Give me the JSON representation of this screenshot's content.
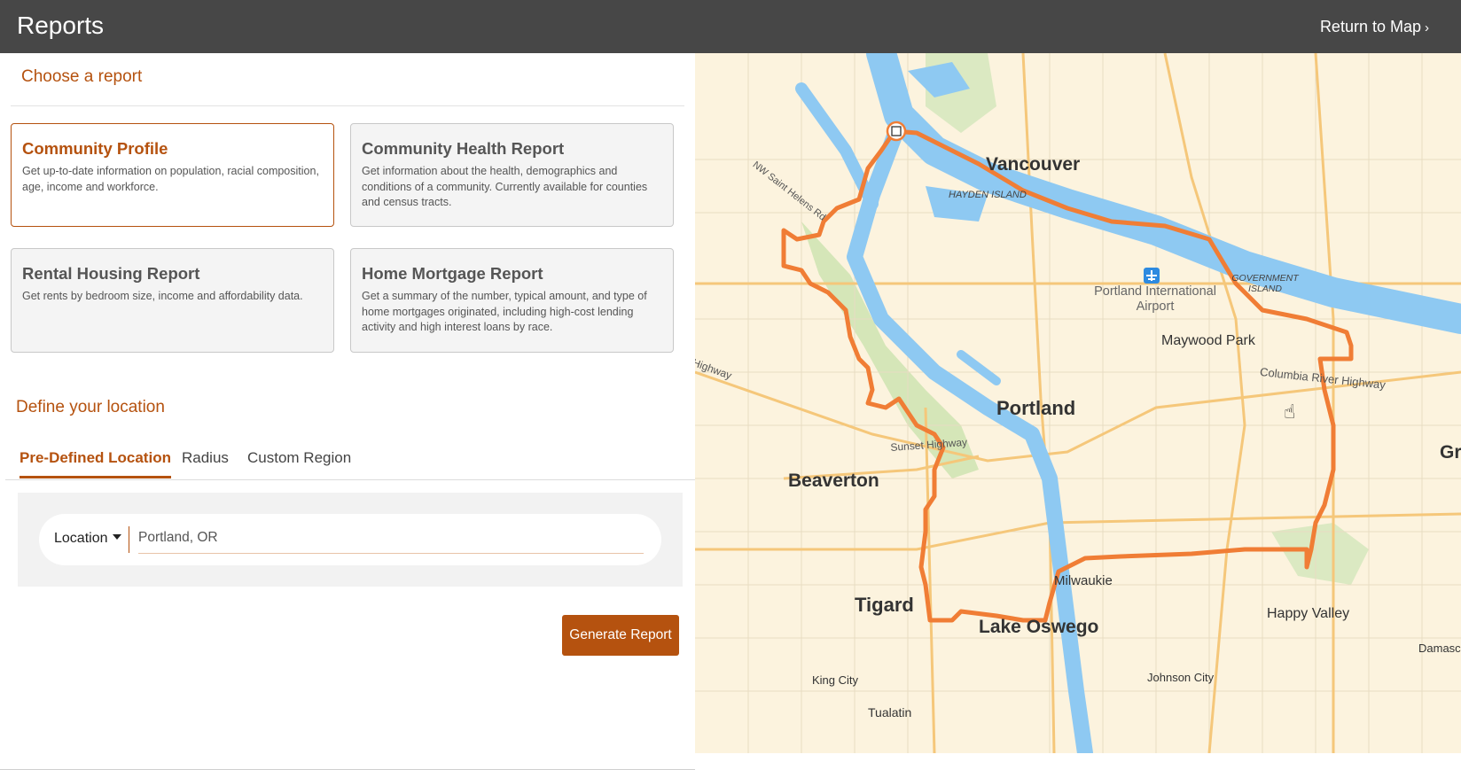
{
  "header": {
    "title": "Reports",
    "return_label": "Return to Map",
    "return_chevron": "›"
  },
  "choose": {
    "title": "Choose a report",
    "cards": [
      {
        "title": "Community Profile",
        "desc": "Get up-to-date information on population, racial composition, age, income and workforce.",
        "active": true
      },
      {
        "title": "Community Health Report",
        "desc": "Get information about the health, demographics and conditions of a community. Currently available for counties and census tracts.",
        "active": false
      },
      {
        "title": "Rental Housing Report",
        "desc": "Get rents by bedroom size, income and affordability data.",
        "active": false
      },
      {
        "title": "Home Mortgage Report",
        "desc": "Get a summary of the number, typical amount, and type of home mortgages originated, including high-cost lending activity and high interest loans by race.",
        "active": false
      }
    ]
  },
  "location": {
    "title": "Define your location",
    "tabs": [
      "Pre-Defined Location",
      "Radius",
      "Custom Region"
    ],
    "active_tab": "Pre-Defined Location",
    "dropdown_label": "Location",
    "input_value": "Portland, OR"
  },
  "generate_label": "Generate Report",
  "map": {
    "labels": [
      {
        "id": "vancouver",
        "text": "Vancouver"
      },
      {
        "id": "hayden",
        "text": "HAYDEN ISLAND"
      },
      {
        "id": "sthelens",
        "text": "NW Saint Helens Rd"
      },
      {
        "id": "airport",
        "text": "Portland International Airport"
      },
      {
        "id": "government",
        "text": "GOVERNMENT ISLAND"
      },
      {
        "id": "maywood",
        "text": "Maywood Park"
      },
      {
        "id": "columbia",
        "text": "Columbia River Highway"
      },
      {
        "id": "highway",
        "text": "Highway"
      },
      {
        "id": "portland",
        "text": "Portland"
      },
      {
        "id": "sunset",
        "text": "Sunset Highway"
      },
      {
        "id": "beaverton",
        "text": "Beaverton"
      },
      {
        "id": "gr",
        "text": "Gr"
      },
      {
        "id": "milwaukie",
        "text": "Milwaukie"
      },
      {
        "id": "tigard",
        "text": "Tigard"
      },
      {
        "id": "lakeoswego",
        "text": "Lake Oswego"
      },
      {
        "id": "happyvalley",
        "text": "Happy Valley"
      },
      {
        "id": "damascus",
        "text": "Damascu"
      },
      {
        "id": "kingcity",
        "text": "King City"
      },
      {
        "id": "johnsoncity",
        "text": "Johnson City"
      },
      {
        "id": "tualatin",
        "text": "Tualatin"
      }
    ],
    "boundary_color": "#f07d35",
    "water_color": "#8ec9f2"
  }
}
